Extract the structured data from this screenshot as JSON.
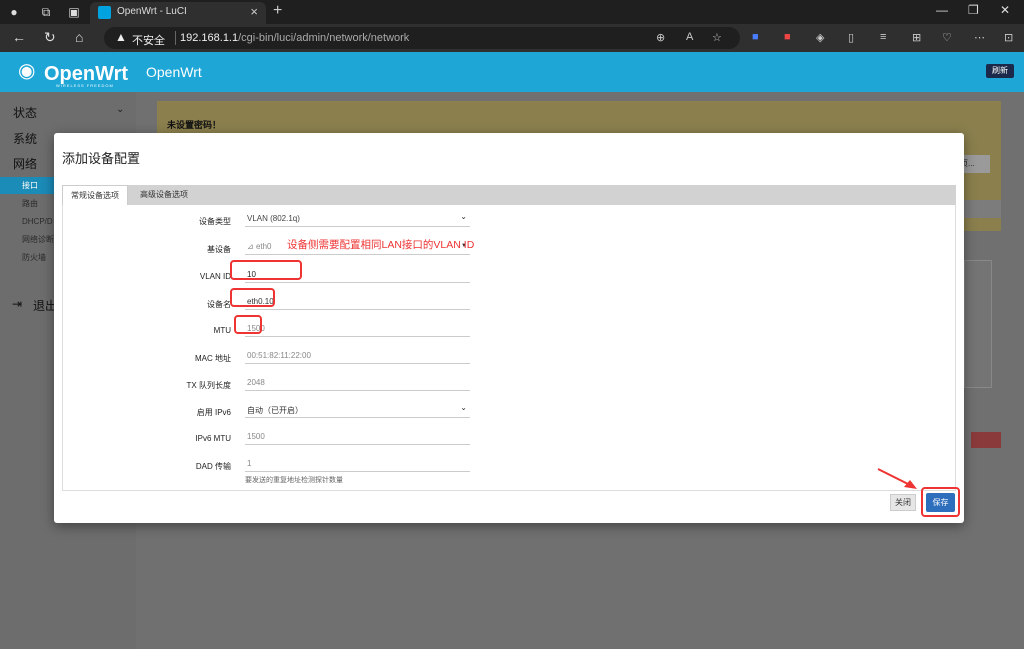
{
  "browser": {
    "tab_title": "OpenWrt - LuCI",
    "security_label": "不安全",
    "url_host": "192.168.1.1",
    "url_path": "/cgi-bin/luci/admin/network/network"
  },
  "header": {
    "logo_text": "OpenWrt",
    "logo_tagline": "WIRELESS FREEDOM",
    "title": "OpenWrt",
    "refresh_label": "刷新",
    "accent": "#1ea6d6"
  },
  "sidebar": {
    "main": [
      "状态",
      "系统",
      "网络",
      "退出"
    ],
    "sub": [
      "接口",
      "路由",
      "DHCP/D",
      "网络诊断",
      "防火墙"
    ]
  },
  "background": {
    "warning_title": "未设置密码！",
    "partial_button": "页..."
  },
  "modal": {
    "title": "添加设备配置",
    "tabs": [
      "常规设备选项",
      "高级设备选项"
    ],
    "fields": [
      {
        "label": "设备类型",
        "value": "VLAN (802.1q)"
      },
      {
        "label": "基设备",
        "value": "eth0"
      },
      {
        "label": "VLAN ID",
        "value": "10"
      },
      {
        "label": "设备名",
        "value": "eth0.10"
      },
      {
        "label": "MTU",
        "value": "1500"
      },
      {
        "label": "MAC 地址",
        "value": "00:51:82:11:22:00"
      },
      {
        "label": "TX 队列长度",
        "value": "2048"
      },
      {
        "label": "启用 IPv6",
        "value": "自动（已开启）"
      },
      {
        "label": "IPv6 MTU",
        "value": "1500"
      },
      {
        "label": "DAD 传输",
        "value": "1"
      }
    ],
    "dad_hint": "要发送的重复地址检测探针数量",
    "annotation": "设备侧需要配置相同LAN接口的VLAN ID",
    "close_label": "关闭",
    "save_label": "保存",
    "save_color": "#2d6ebd",
    "annotation_color": "#ee3333"
  }
}
